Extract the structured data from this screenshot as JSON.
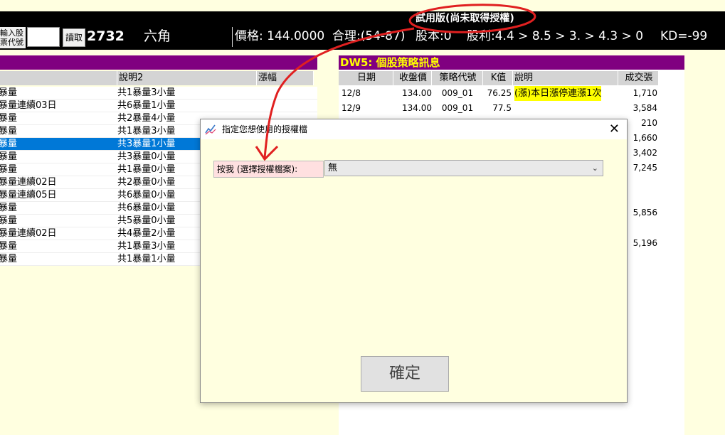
{
  "trial_banner": "試用版(尚未取得授權)",
  "header": {
    "code_label_line1": "輸入股",
    "code_label_line2": "票代號",
    "read_button": "讀取",
    "stock_code": "2732",
    "stock_name": "六角",
    "price": "價格: 144.0000",
    "fair": "合理:(54-87)",
    "capital": "股本:0",
    "dividend": "股利:4.4 > 8.5 > 3. > 4.3 > 0",
    "kd": "KD=-99"
  },
  "left_table": {
    "columns": [
      "說明2",
      "漲幅"
    ],
    "rows": [
      {
        "c1": "暴量",
        "c2": "共1暴量3小量",
        "selected": false
      },
      {
        "c1": "暴量連續03日",
        "c2": "共6暴量1小量",
        "selected": false
      },
      {
        "c1": "暴量",
        "c2": "共2暴量4小量",
        "selected": false
      },
      {
        "c1": "暴量",
        "c2": "共1暴量3小量",
        "selected": false
      },
      {
        "c1": "暴量",
        "c2": "共3暴量1小量",
        "selected": true
      },
      {
        "c1": "暴量",
        "c2": "共3暴量0小量",
        "selected": false
      },
      {
        "c1": "暴量",
        "c2": "共1暴量0小量",
        "selected": false
      },
      {
        "c1": "暴量連續02日",
        "c2": "共2暴量0小量",
        "selected": false
      },
      {
        "c1": "暴量連續05日",
        "c2": "共6暴量0小量",
        "selected": false
      },
      {
        "c1": "暴量",
        "c2": "共6暴量0小量",
        "selected": false
      },
      {
        "c1": "暴量",
        "c2": "共5暴量0小量",
        "selected": false
      },
      {
        "c1": "暴量連續02日",
        "c2": "共4暴量2小量",
        "selected": false
      },
      {
        "c1": "暴量",
        "c2": "共1暴量3小量",
        "selected": false
      },
      {
        "c1": "暴量",
        "c2": "共1暴量1小量",
        "selected": false
      }
    ]
  },
  "right_panel": {
    "title": "DW5: 個股策略訊息",
    "columns": [
      "日期",
      "收盤價",
      "策略代號",
      "K值",
      "說明",
      "成交張"
    ],
    "rows": [
      {
        "date": "12/8",
        "close": "134.00",
        "code": "009_01",
        "k": "76.25",
        "desc": "(漲)本日漲停連漲1次",
        "vol": "1,710"
      },
      {
        "date": "12/9",
        "close": "134.00",
        "code": "009_01",
        "k": "77.5",
        "desc": "",
        "vol": "3,584"
      }
    ],
    "extra_volumes": [
      "210",
      "1,660",
      "3,402",
      "7,245",
      "5,856",
      "5,196"
    ]
  },
  "dialog": {
    "title": "指定您想使用的授權檔",
    "close_glyph": "✕",
    "pick_button": "按我 (選擇授權檔案):",
    "select_value": "無",
    "ok_button": "確定"
  },
  "colors": {
    "accent_purple": "#800080",
    "highlight_yellow": "#ffff00",
    "selection_blue": "#0078d7",
    "annotation_red": "#e02020"
  }
}
